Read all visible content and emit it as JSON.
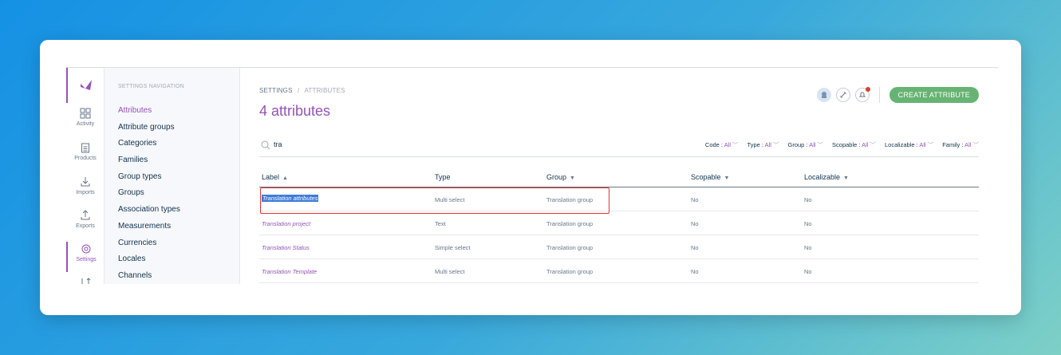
{
  "rail": {
    "items": [
      {
        "label": "Activity",
        "icon": "activity-grid-icon"
      },
      {
        "label": "Products",
        "icon": "clipboard-icon"
      },
      {
        "label": "Imports",
        "icon": "import-icon"
      },
      {
        "label": "Exports",
        "icon": "export-icon"
      },
      {
        "label": "Settings",
        "icon": "gear-icon"
      }
    ]
  },
  "nav": {
    "title": "SETTINGS NAVIGATION",
    "items": [
      "Attributes",
      "Attribute groups",
      "Categories",
      "Families",
      "Group types",
      "Groups",
      "Association types",
      "Measurements",
      "Currencies",
      "Locales",
      "Channels"
    ]
  },
  "breadcrumb": {
    "root": "SETTINGS",
    "separator": "/",
    "current": "ATTRIBUTES"
  },
  "page_title": "4 attributes",
  "actions": {
    "create_label": "CREATE ATTRIBUTE"
  },
  "search": {
    "value": "tra"
  },
  "filters": [
    {
      "name": "Code",
      "value": "All"
    },
    {
      "name": "Type",
      "value": "All"
    },
    {
      "name": "Group",
      "value": "All"
    },
    {
      "name": "Scopable",
      "value": "All"
    },
    {
      "name": "Localizable",
      "value": "All"
    },
    {
      "name": "Family",
      "value": "All"
    }
  ],
  "table": {
    "columns": [
      "Label",
      "Type",
      "Group",
      "Scopable",
      "Localizable"
    ],
    "rows": [
      {
        "label": "Translation attributes",
        "type": "Multi select",
        "group": "Translation group",
        "scopable": "No",
        "localizable": "No"
      },
      {
        "label": "Translation project",
        "type": "Text",
        "group": "Translation group",
        "scopable": "No",
        "localizable": "No"
      },
      {
        "label": "Translation Status",
        "type": "Simple select",
        "group": "Translation group",
        "scopable": "No",
        "localizable": "No"
      },
      {
        "label": "Translation Template",
        "type": "Multi select",
        "group": "Translation group",
        "scopable": "No",
        "localizable": "No"
      }
    ]
  },
  "colors": {
    "accent": "#9452ba",
    "create_button": "#67b373",
    "highlight": "#e03535",
    "selection": "#3f7bd9"
  }
}
